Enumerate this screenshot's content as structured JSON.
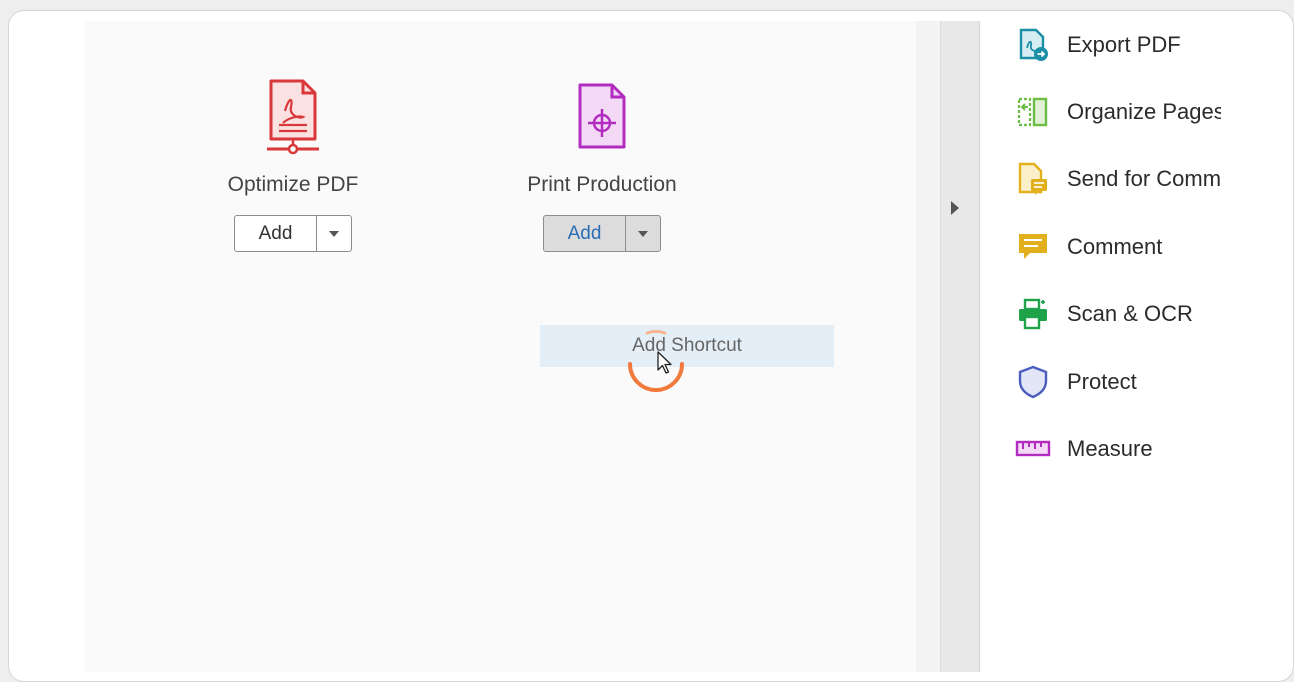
{
  "tools": [
    {
      "title": "Optimize PDF",
      "add_label": "Add",
      "icon": "optimize-pdf-icon",
      "color": "#d9383a"
    },
    {
      "title": "Print Production",
      "add_label": "Add",
      "icon": "print-production-icon",
      "color": "#b22dbf"
    }
  ],
  "dropdown": {
    "item_label": "Add Shortcut"
  },
  "right_panel": {
    "items": [
      {
        "label": "Export PDF",
        "icon": "export-pdf-icon",
        "color": "#1b8fa5"
      },
      {
        "label": "Organize Pages",
        "icon": "organize-pages-icon",
        "color": "#6cbd45"
      },
      {
        "label": "Send for Comm",
        "icon": "send-for-comment-icon",
        "color": "#e1b01c"
      },
      {
        "label": "Comment",
        "icon": "comment-icon",
        "color": "#e1b01c"
      },
      {
        "label": "Scan & OCR",
        "icon": "scan-ocr-icon",
        "color": "#1ea34a"
      },
      {
        "label": "Protect",
        "icon": "protect-icon",
        "color": "#4b5dbf"
      },
      {
        "label": "Measure",
        "icon": "measure-icon",
        "color": "#b22dbf"
      }
    ]
  },
  "colors": {
    "accent_blue": "#2a6db5",
    "spinner_orange": "#f07a3c",
    "menu_highlight": "#e3eef6"
  }
}
